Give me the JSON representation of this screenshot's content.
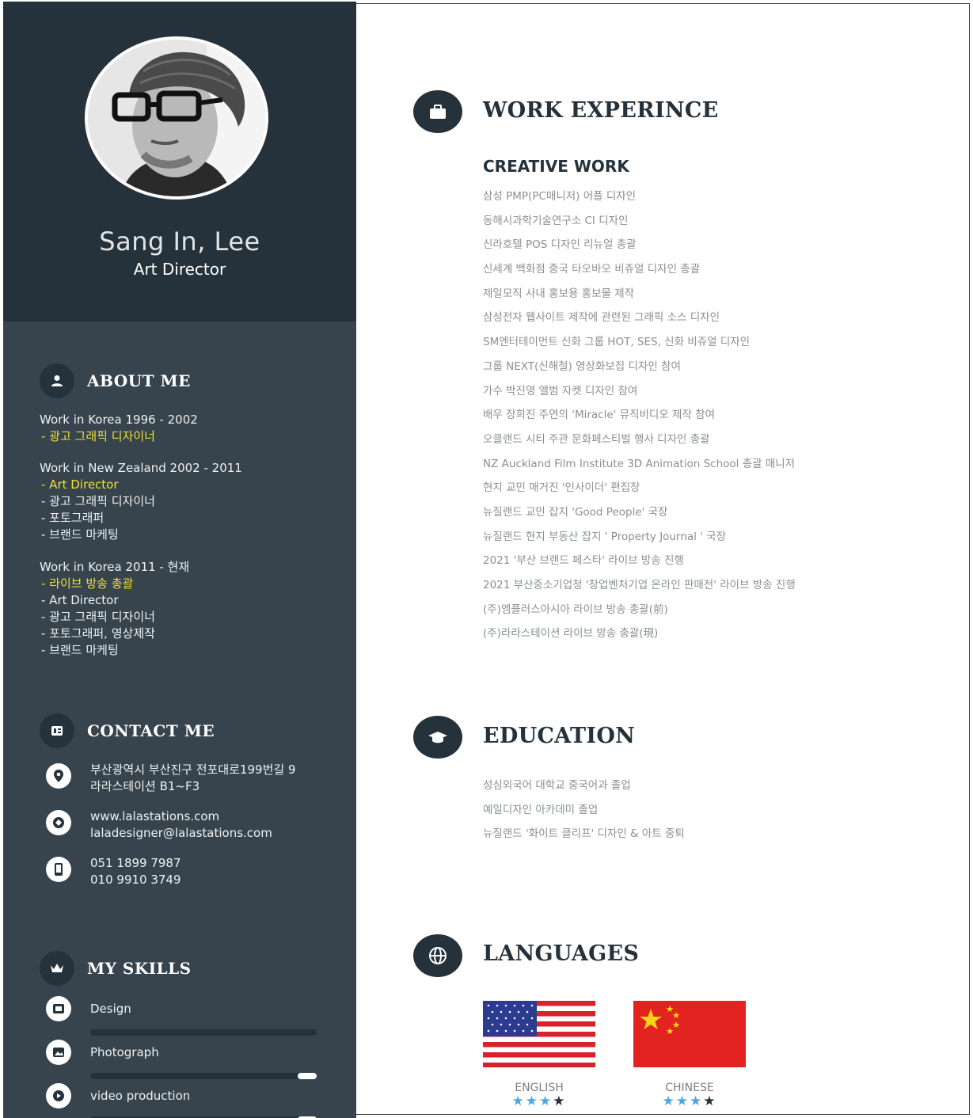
{
  "profile": {
    "name": "Sang In, Lee",
    "role": "Art Director"
  },
  "about": {
    "title": "ABOUT ME",
    "blocks": [
      {
        "heading": "Work in Korea 1996 - 2002",
        "items": [
          {
            "text": "- 광고 그래픽 디자이너",
            "highlight": true
          }
        ]
      },
      {
        "heading": "Work in New Zealand 2002 - 2011",
        "items": [
          {
            "text": "- Art Director",
            "highlight": true
          },
          {
            "text": "- 광고 그래픽 디자이너",
            "highlight": false
          },
          {
            "text": "- 포토그래퍼",
            "highlight": false
          },
          {
            "text": "- 브랜드 마케팅",
            "highlight": false
          }
        ]
      },
      {
        "heading": "Work in Korea 2011 - 현재",
        "items": [
          {
            "text": "- 라이브 방송 총괄",
            "highlight": true
          },
          {
            "text": "- Art Director",
            "highlight": false
          },
          {
            "text": "- 광고 그래픽 디자이너",
            "highlight": false
          },
          {
            "text": "- 포토그래퍼, 영상제작",
            "highlight": false
          },
          {
            "text": "- 브랜드 마케팅",
            "highlight": false
          }
        ]
      }
    ]
  },
  "contact": {
    "title": "CONTACT ME",
    "address": [
      "부산광역시 부산진구 전포대로199번길 9",
      "라라스테이션 B1~F3"
    ],
    "web": [
      "www.lalastations.com",
      "laladesigner@lalastations.com"
    ],
    "phone": [
      "051 1899 7987",
      "010 9910 3749"
    ]
  },
  "skills": {
    "title": "MY SKILLS",
    "items": [
      {
        "label": "Design",
        "level": 1.0,
        "icon": "design-icon"
      },
      {
        "label": "Photograph",
        "level": 0.92,
        "icon": "photo-icon"
      },
      {
        "label": "video production",
        "level": 0.92,
        "icon": "video-icon"
      }
    ]
  },
  "work": {
    "title": "WORK EXPERINCE",
    "subtitle": "CREATIVE WORK",
    "items": [
      "삼성 PMP(PC매니저) 어플 디자인",
      "동해시과학기술연구소 CI 디자인",
      "신라호텔 POS 디자인 리뉴얼 총괄",
      "신세계 백화점 중국 타오바오 비쥬얼 디자인 총괄",
      "제일모직 사내 홍보용 홍보물 제작",
      "삼성전자 웹사이트 제작에 관련된 그래픽 소스 디자인",
      "SM엔터테이먼트 신화 그룹 HOT, SES, 신화 비쥬얼 디자인",
      "그룹 NEXT(신해철) 영상화보집 디자인 참여",
      "가수 박진영 앨범 자켓 디자인 참여",
      "배우 장희진 주연의 'Miracle' 뮤직비디오 제작 참여",
      "오클랜드 시티 주관 문화페스티벌 행사 디자인 총괄",
      "NZ Auckland Film Institute 3D Animation School 총괄 매니저",
      "현지 교민 매거진 '인사이더' 편집장",
      "뉴질랜드 교민 잡지 'Good People' 국장",
      "뉴질랜드 현지 부동산 잡지 ' Property Journal ' 국장",
      "2021 '부산 브랜드 페스타' 라이브 방송 진행",
      "2021 부산중소기업청 '창업벤처기업 온라인 판매전' 라이브 방송 진행",
      "(주)엠플러스아시아 라이브 방송 총괄(前)",
      "(주)라라스테이션 라이브 방송 총괄(現)"
    ]
  },
  "education": {
    "title": "EDUCATION",
    "items": [
      "성심외국어 대학교 중국어과 졸업",
      "예일디자인 아카데미 졸업",
      "뉴질랜드 '화이트 클리프' 디자인 & 아트 중퇴"
    ]
  },
  "languages": {
    "title": "LANGUAGES",
    "items": [
      {
        "name": "ENGLISH",
        "stars": 3,
        "max": 4
      },
      {
        "name": "CHINESE",
        "stars": 3,
        "max": 4
      }
    ]
  },
  "colors": {
    "sidebar": "#37444e",
    "sidebar_dark": "#25323b",
    "highlight": "#f0df3a",
    "star": "#4aa8e0"
  }
}
